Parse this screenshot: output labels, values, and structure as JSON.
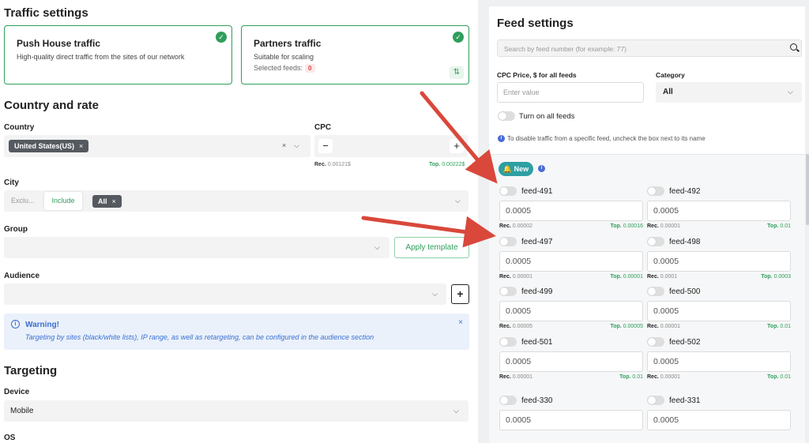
{
  "traffic_settings": {
    "title": "Traffic settings",
    "push_house": {
      "title": "Push House traffic",
      "subtitle": "High-quality direct traffic from the sites of our network"
    },
    "partners": {
      "title": "Partners traffic",
      "subtitle": "Suitable for scaling",
      "selected_label": "Selected feeds:",
      "selected_count": "0"
    }
  },
  "country_rate": {
    "title": "Country and rate",
    "country_label": "Country",
    "country_chip": "United States(US)",
    "cpc_label": "CPC",
    "cpc_minus": "−",
    "cpc_plus": "+",
    "rec_label": "Rec.",
    "rec_value": "0.00121$",
    "top_label": "Top.",
    "top_value": "0.00222$",
    "city_label": "City",
    "exclude_label": "Exclu...",
    "include_label": "Include",
    "city_chip": "All",
    "group_label": "Group",
    "apply_template": "Apply template",
    "audience_label": "Audience",
    "audience_plus": "+"
  },
  "warning": {
    "title": "Warning!",
    "text": "Targeting by sites (black/white lists), IP range, as well as retargeting, can be configured in the audience section",
    "close": "×"
  },
  "targeting": {
    "title": "Targeting",
    "device_label": "Device",
    "device_value": "Mobile",
    "os_label": "OS"
  },
  "feed_settings": {
    "title": "Feed settings",
    "search_placeholder": "Search by feed number (for example: 77)",
    "cpc_all_label": "CPC Price, $ for all feeds",
    "cpc_all_placeholder": "Enter value",
    "category_label": "Category",
    "category_value": "All",
    "turn_on_label": "Turn on all feeds",
    "info_text": "To disable traffic from a specific feed, uncheck the box next to its name",
    "new_label": "New",
    "feeds": [
      {
        "name": "feed-491",
        "value": "0.0005",
        "rec": "0.00002",
        "top": "0.00016"
      },
      {
        "name": "feed-492",
        "value": "0.0005",
        "rec": "0.00001",
        "top": "0.01"
      },
      {
        "name": "feed-497",
        "value": "0.0005",
        "rec": "0.00001",
        "top": "0.00001"
      },
      {
        "name": "feed-498",
        "value": "0.0005",
        "rec": "0.0001",
        "top": "0.0003"
      },
      {
        "name": "feed-499",
        "value": "0.0005",
        "rec": "0.00005",
        "top": "0.00005"
      },
      {
        "name": "feed-500",
        "value": "0.0005",
        "rec": "0.00001",
        "top": "0.01"
      },
      {
        "name": "feed-501",
        "value": "0.0005",
        "rec": "0.00001",
        "top": "0.01"
      },
      {
        "name": "feed-502",
        "value": "0.0005",
        "rec": "0.00001",
        "top": "0.01"
      },
      {
        "name": "feed-330",
        "value": "0.0005"
      },
      {
        "name": "feed-331",
        "value": "0.0005"
      }
    ],
    "rec_label": "Rec.",
    "top_label": "Top."
  },
  "colors": {
    "accent_green": "#2f9e5b",
    "arrow_red": "#d9483b",
    "new_teal": "#2e9fa3",
    "info_blue": "#3a6fd1"
  }
}
